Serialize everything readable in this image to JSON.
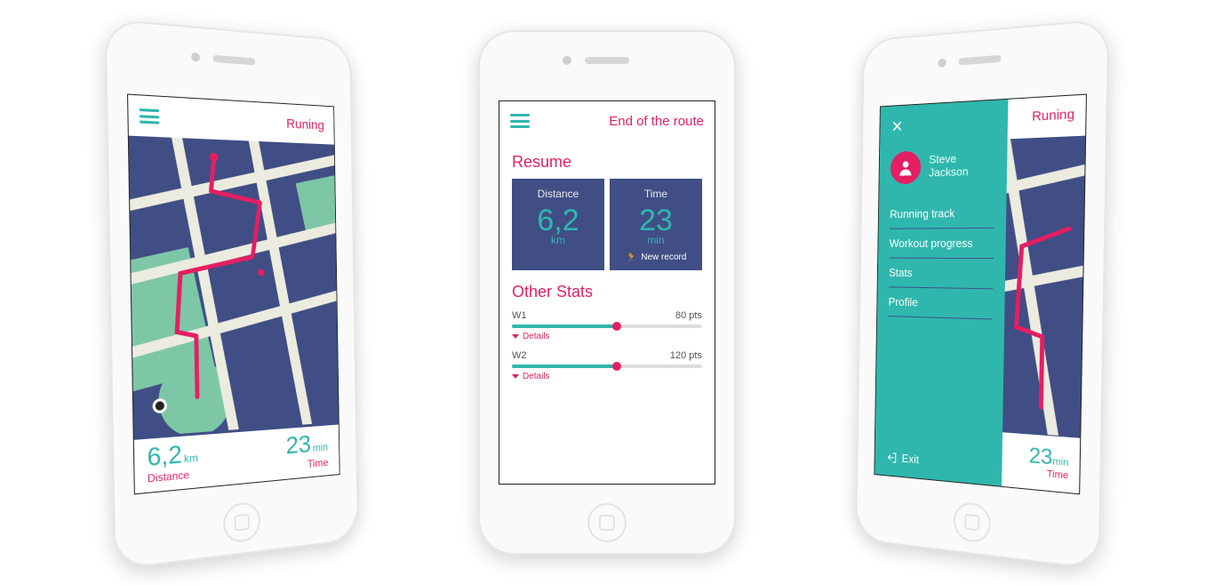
{
  "colors": {
    "teal": "#2fb7ad",
    "pink": "#e41e63",
    "navy": "#404e85"
  },
  "screen1": {
    "title": "Runing",
    "distance": {
      "value": "6,2",
      "unit": "km",
      "label": "Distance"
    },
    "time": {
      "value": "23",
      "unit": "min",
      "label": "Time"
    }
  },
  "screen2": {
    "title": "End of the route",
    "resume_label": "Resume",
    "cards": {
      "distance": {
        "label": "Distance",
        "value": "6,2",
        "unit": "km"
      },
      "time": {
        "label": "Time",
        "value": "23",
        "unit": "min",
        "record": "New record"
      }
    },
    "other_stats_label": "Other Stats",
    "rows": [
      {
        "name": "W1",
        "points": "80 pts",
        "fill_pct": 55,
        "details": "Details"
      },
      {
        "name": "W2",
        "points": "120 pts",
        "fill_pct": 55,
        "details": "Details"
      }
    ]
  },
  "screen3": {
    "title": "Runing",
    "user": {
      "first": "Steve",
      "last": "Jackson"
    },
    "menu": [
      "Running track",
      "Workout progress",
      "Stats",
      "Profile"
    ],
    "exit": "Exit",
    "time": {
      "value": "23",
      "unit": "min",
      "label": "Time"
    }
  }
}
